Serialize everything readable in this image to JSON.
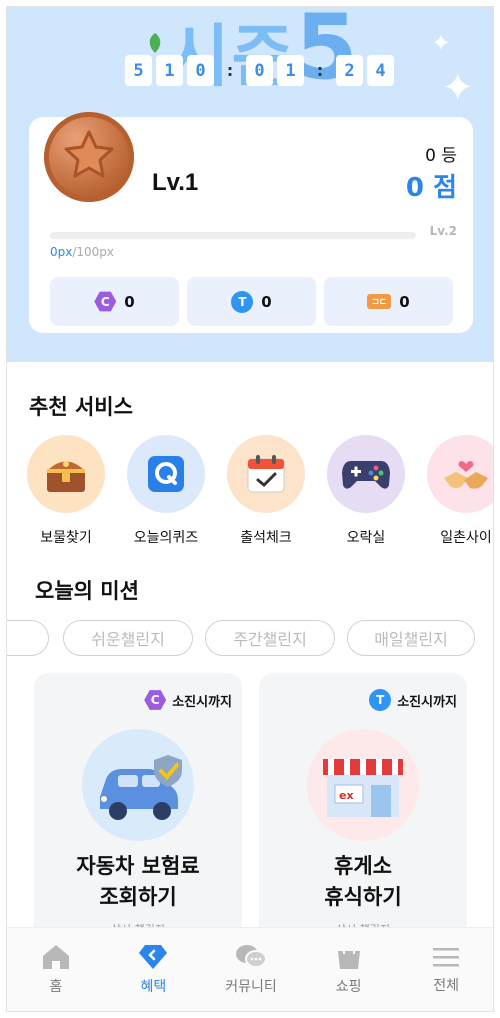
{
  "timer": {
    "digits": [
      "5",
      "1",
      "0",
      ":",
      "0",
      "1",
      ":",
      "2",
      "4"
    ]
  },
  "profile": {
    "level": "Lv.1",
    "rank": "0 등",
    "score": "0 점",
    "next_level": "Lv.2",
    "xp_current": "0px",
    "xp_max": "/100px",
    "xp_progress": 0
  },
  "wallet": [
    {
      "icon": "c-coin-icon",
      "icon_text": "C",
      "value": "0"
    },
    {
      "icon": "t-coin-icon",
      "icon_text": "T",
      "value": "0"
    },
    {
      "icon": "ticket-icon",
      "icon_text": "",
      "value": "0"
    }
  ],
  "services": {
    "title": "추천 서비스",
    "items": [
      {
        "label": "보물찾기",
        "icon": "treasure-chest-icon",
        "bg": "#fde3c2"
      },
      {
        "label": "오늘의퀴즈",
        "icon": "quiz-icon",
        "bg": "#dbe9fb"
      },
      {
        "label": "출석체크",
        "icon": "calendar-check-icon",
        "bg": "#fde3c9"
      },
      {
        "label": "오락실",
        "icon": "gamepad-icon",
        "bg": "#e6dcf4"
      },
      {
        "label": "일촌사이",
        "icon": "handshake-icon",
        "bg": "#fde2ea"
      }
    ]
  },
  "missions": {
    "title": "오늘의 미션",
    "tabs": [
      "쉬운챌린지",
      "주간챌린지",
      "매일챌린지"
    ],
    "cards": [
      {
        "tag_icon_text": "C",
        "tag": "소진시까지",
        "title_line1": "자동차 보험료",
        "title_line2": "조회하기",
        "subtitle": "상시 챌린지"
      },
      {
        "tag_icon_text": "T",
        "tag": "소진시까지",
        "title_line1": "휴게소",
        "title_line2": "휴식하기",
        "subtitle": "상시 챌린지"
      }
    ]
  },
  "nav": [
    {
      "label": "홈",
      "icon": "home-icon"
    },
    {
      "label": "혜택",
      "icon": "benefit-diamond-icon",
      "active": true
    },
    {
      "label": "커뮤니티",
      "icon": "chat-bubbles-icon"
    },
    {
      "label": "쇼핑",
      "icon": "shopping-bag-icon"
    },
    {
      "label": "전체",
      "icon": "menu-icon"
    }
  ],
  "colors": {
    "accent": "#2b86ec",
    "hero_bg": "#cfe6fc"
  }
}
